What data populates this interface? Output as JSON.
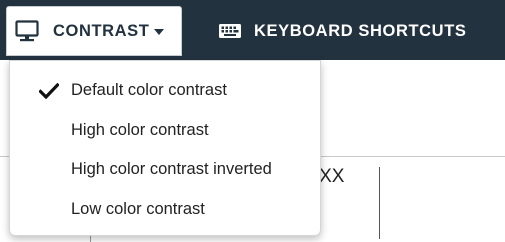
{
  "toolbar": {
    "contrast_label": "CONTRAST",
    "keyboard_label": "KEYBOARD SHORTCUTS",
    "background_color": "#23323f",
    "icons": {
      "contrast": "monitor-icon",
      "dropdown": "caret-down-icon",
      "keyboard": "keyboard-icon"
    }
  },
  "contrast_menu": {
    "items": [
      {
        "label": "Default color contrast",
        "selected": true
      },
      {
        "label": "High color contrast",
        "selected": false
      },
      {
        "label": "High color contrast inverted",
        "selected": false
      },
      {
        "label": "Low color contrast",
        "selected": false
      }
    ],
    "selected_icon": "checkmark-icon"
  },
  "background": {
    "text": "20XX"
  }
}
